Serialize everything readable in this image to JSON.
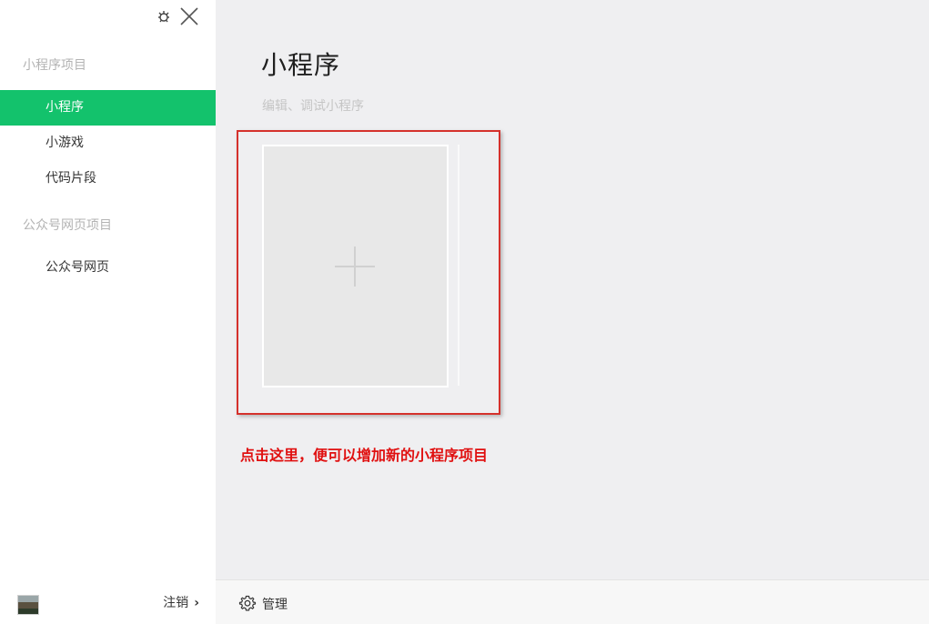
{
  "sidebar": {
    "section_miniprogram": "小程序项目",
    "items_miniprogram": [
      {
        "label": "小程序",
        "active": true
      },
      {
        "label": "小游戏",
        "active": false
      },
      {
        "label": "代码片段",
        "active": false
      }
    ],
    "section_official": "公众号网页项目",
    "items_official": [
      {
        "label": "公众号网页",
        "active": false
      }
    ],
    "logout_label": "注销",
    "icons": {
      "debug": "bug-icon",
      "close": "close-icon",
      "logout_arrow": "chevron-right-icon"
    }
  },
  "main": {
    "title": "小程序",
    "subtitle": "编辑、调试小程序",
    "annotation": "点击这里，便可以增加新的小程序项目",
    "manage_label": "管理"
  },
  "colors": {
    "accent": "#13c26c",
    "annotation": "#e01010",
    "highlight_border": "#d5312c"
  }
}
